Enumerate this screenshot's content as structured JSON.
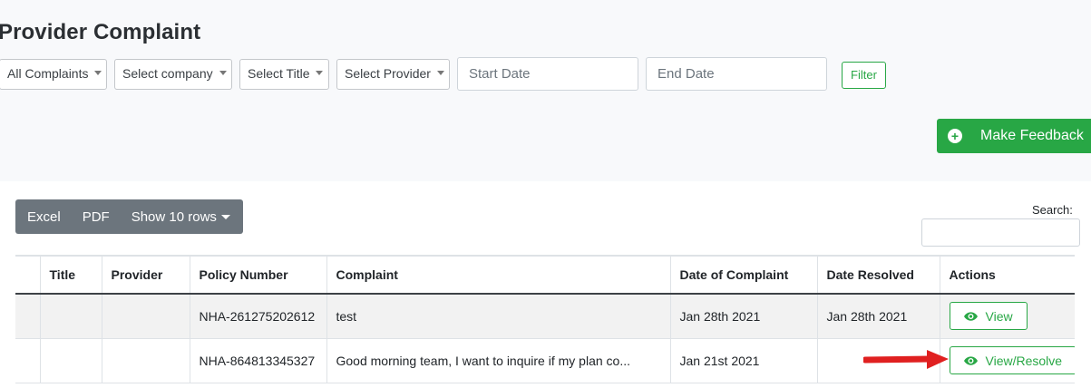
{
  "page": {
    "title": "Provider Complaint"
  },
  "filters": {
    "complaints_select": "All Complaints",
    "company_select": "Select company",
    "title_select": "Select Title",
    "provider_select": "Select Provider",
    "start_date_placeholder": "Start Date",
    "end_date_placeholder": "End Date",
    "filter_label": "Filter"
  },
  "actions": {
    "make_feedback_label": "Make Feedback"
  },
  "toolbar": {
    "excel_label": "Excel",
    "pdf_label": "PDF",
    "rows_label": "Show 10 rows"
  },
  "search": {
    "label": "Search:"
  },
  "table": {
    "columns": [
      "",
      "Title",
      "Provider",
      "Policy Number",
      "Complaint",
      "Date of Complaint",
      "Date Resolved",
      "Actions"
    ],
    "rows": [
      {
        "title": "",
        "provider": "",
        "policy_number": "NHA-261275202612",
        "complaint": "test",
        "date_of_complaint": "Jan 28th 2021",
        "date_resolved": "Jan 28th 2021",
        "action_label": "View"
      },
      {
        "title": "",
        "provider": "",
        "policy_number": "NHA-864813345327",
        "complaint": "Good morning team, I want to inquire if my plan co...",
        "date_of_complaint": "Jan 21st 2021",
        "date_resolved": "",
        "action_label": "View/Resolve"
      }
    ]
  },
  "colors": {
    "success": "#28a745",
    "toolbar_gray": "#6c757d",
    "annotation_arrow": "#e02020"
  },
  "icons": {
    "feedback_icon": "plus-circle-icon",
    "view_icon": "eye-icon",
    "annotation": "red-arrow-icon"
  }
}
